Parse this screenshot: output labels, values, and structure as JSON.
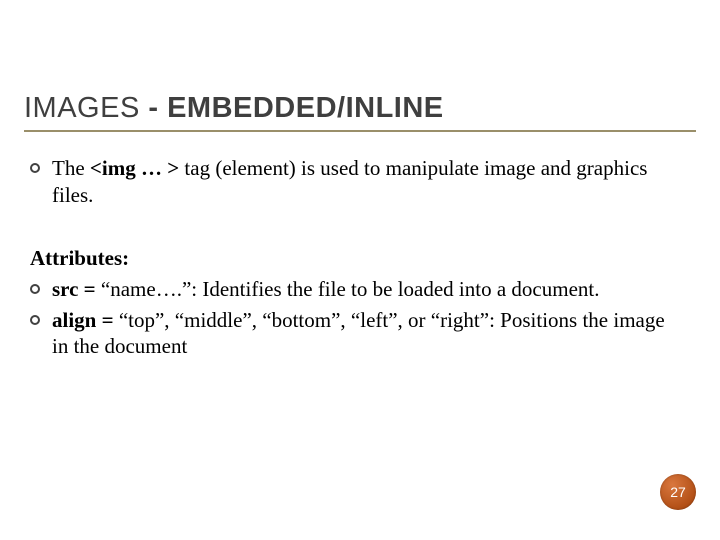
{
  "title_plain": "IMAGES ",
  "title_bold": "- EMBEDDED/INLINE",
  "bullets": {
    "intro_pre": "The ",
    "intro_tag": "<img … >",
    "intro_post": " tag (element) is used to manipulate image and graphics files."
  },
  "attributes_label": "Attributes:",
  "attr_items": {
    "src_bold": "src = ",
    "src_rest": "“name….”: Identifies the file to be loaded into a document.",
    "align_bold": "align = ",
    "align_rest": "“top”, “middle”, “bottom”, “left”, or “right”: Positions the image in the document"
  },
  "page_number": "27"
}
